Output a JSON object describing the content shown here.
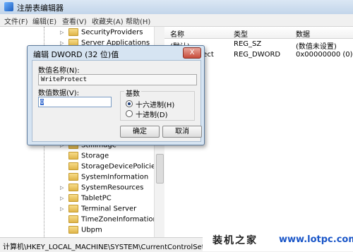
{
  "window": {
    "title": "注册表编辑器"
  },
  "menu": [
    "文件(F)",
    "编辑(E)",
    "查看(V)",
    "收藏夹(A)",
    "帮助(H)"
  ],
  "tree": {
    "items": [
      "SecurityProviders",
      "Server Applications",
      "StillImage",
      "Storage",
      "StorageDevicePolicies",
      "SystemInformation",
      "SystemResources",
      "TabletPC",
      "Terminal Server",
      "TimeZoneInformation",
      "Ubpm"
    ]
  },
  "list": {
    "columns": [
      "名称",
      "类型",
      "数据"
    ],
    "rows": [
      {
        "name": "(默认)",
        "type": "REG_SZ",
        "data": "(数值未设置)"
      },
      {
        "name": "WriteProtect",
        "type": "REG_DWORD",
        "data": "0x00000000 (0)"
      }
    ]
  },
  "status": {
    "path": "计算机\\HKEY_LOCAL_MACHINE\\SYSTEM\\CurrentControlSet\\Control"
  },
  "watermark": {
    "cn": "装机之家",
    "url": "www.lotpc.com"
  },
  "dialog": {
    "title": "编辑 DWORD (32 位)值",
    "close": "X",
    "value_name_label": "数值名称(N):",
    "value_name": "WriteProtect",
    "value_data_label": "数值数据(V):",
    "value_data": "0",
    "base_label": "基数",
    "hex_label": "十六进制(H)",
    "dec_label": "十进制(D)",
    "base_selected": "十六进制(H)",
    "ok": "确定",
    "cancel": "取消"
  }
}
